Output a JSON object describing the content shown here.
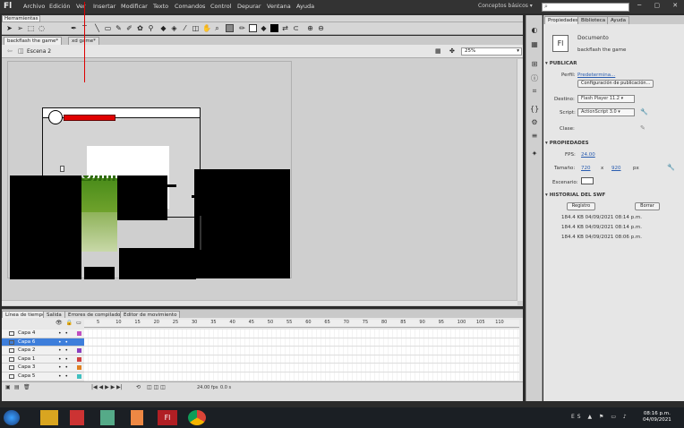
{
  "app": {
    "logo": "Fl",
    "menus": [
      "Archivo",
      "Edición",
      "Ver",
      "Insertar",
      "Modificar",
      "Texto",
      "Comandos",
      "Control",
      "Depurar",
      "Ventana",
      "Ayuda"
    ],
    "workspace": "Conceptos básicos ▾",
    "window_controls": "─ ▢ ✕"
  },
  "tools": {
    "panel_title": "Herramientas",
    "icons": [
      "arrow-icon",
      "subselect-icon",
      "free-transform-icon",
      "lasso-icon",
      "text-icon",
      "line-icon",
      "rect-icon",
      "oval-icon",
      "pencil-icon",
      "brush-icon",
      "deco-icon",
      "bone-icon",
      "paint-bucket-icon",
      "ink-bottle-icon",
      "eyedropper-icon",
      "eraser-icon",
      "hand-icon",
      "zoom-icon"
    ]
  },
  "documents": {
    "tabs": [
      "backflash the game*",
      "xd game*"
    ],
    "scene": "Escena 2",
    "zoom": "25%"
  },
  "timeline": {
    "tabs": [
      "Línea de tiempo",
      "Salida",
      "Errores de compilador",
      "Editor de movimiento"
    ],
    "frame_ticks": [
      "5",
      "10",
      "15",
      "20",
      "25",
      "30",
      "35",
      "40",
      "45",
      "50",
      "55",
      "60",
      "65",
      "70",
      "75",
      "80",
      "85",
      "90",
      "95",
      "100",
      "105",
      "110"
    ],
    "layers": [
      {
        "name": "Capa 4",
        "color": "#c050c0",
        "selected": false
      },
      {
        "name": "Capa 6",
        "color": "#3d7edb",
        "selected": true
      },
      {
        "name": "Capa 2",
        "color": "#8a40c0",
        "selected": false
      },
      {
        "name": "Capa 1",
        "color": "#d04040",
        "selected": false
      },
      {
        "name": "Capa 3",
        "color": "#e08020",
        "selected": false
      },
      {
        "name": "Capa 5",
        "color": "#40c0c0",
        "selected": false
      }
    ],
    "fps": "24.00 fps",
    "time": "0.0 s"
  },
  "properties": {
    "tabs": [
      "Propiedades",
      "Biblioteca",
      "Ayuda"
    ],
    "doc_icon": "Fl",
    "doc_type": "Documento",
    "doc_name": "backflash the game",
    "publish_section": "PUBLICAR",
    "profile_label": "Perfil:",
    "profile_value": "Predetermina...",
    "publish_settings": "Configuración de publicación...",
    "target_label": "Destino:",
    "target_value": "Flash Player 11.2",
    "script_label": "Script:",
    "script_value": "ActionScript 3.0",
    "class_label": "Clase:",
    "props_section": "PROPIEDADES",
    "fps_label": "FPS:",
    "fps_value": "24.00",
    "size_label": "Tamaño:",
    "width": "720",
    "x": "x",
    "height": "920",
    "unit": "px",
    "stage_label": "Escenario:",
    "history_section": "HISTORIAL DEL SWF",
    "register_btn": "Registro",
    "clear_btn": "Borrar",
    "history": [
      "184.4 KB   04/09/2021   08:14 p.m.",
      "184.4 KB   04/09/2021   08:14 p.m.",
      "184.4 KB   04/09/2021   08:06 p.m."
    ]
  },
  "taskbar": {
    "lang": "ES",
    "time": "08:16 p.m.",
    "date": "04/09/2021"
  }
}
